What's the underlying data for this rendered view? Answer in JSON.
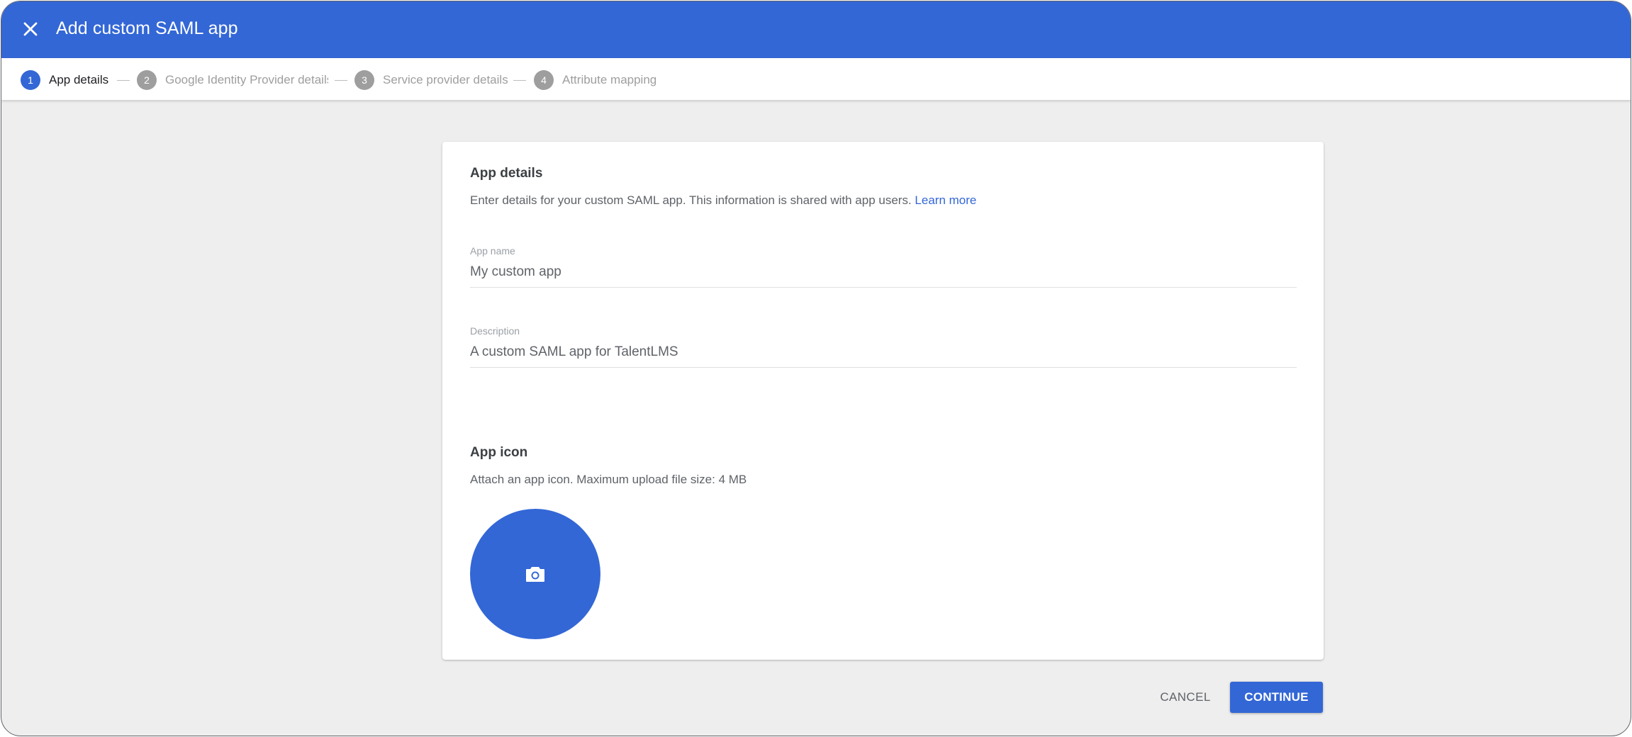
{
  "header": {
    "title": "Add custom SAML app",
    "close_icon": "close-icon",
    "background": "#3367d6"
  },
  "stepper": {
    "steps": [
      {
        "number": "1",
        "label": "App details",
        "active": true
      },
      {
        "number": "2",
        "label": "Google Identity Provider details",
        "active": false
      },
      {
        "number": "3",
        "label": "Service provider details",
        "active": false
      },
      {
        "number": "4",
        "label": "Attribute mapping",
        "active": false
      }
    ]
  },
  "app_details": {
    "title": "App details",
    "description": "Enter details for your custom SAML app. This information is shared with app users.",
    "learn_more": "Learn more"
  },
  "fields": {
    "app_name": {
      "label": "App name",
      "value": "My custom app"
    },
    "description": {
      "label": "Description",
      "value": "A custom SAML app for TalentLMS"
    }
  },
  "app_icon": {
    "title": "App icon",
    "description": "Attach an app icon. Maximum upload file size: 4 MB",
    "icon": "camera-icon"
  },
  "footer": {
    "cancel_label": "CANCEL",
    "continue_label": "CONTINUE"
  },
  "colors": {
    "accent": "#3367d6",
    "page_background": "#eeeeee",
    "inactive_step": "#9e9e9e"
  }
}
